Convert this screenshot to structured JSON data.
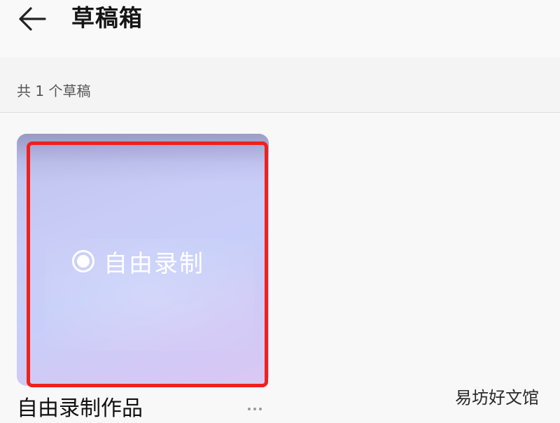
{
  "header": {
    "title": "草稿箱",
    "back_icon": "arrow-left-icon"
  },
  "draft_count": {
    "text": "共 1 个草稿"
  },
  "drafts": [
    {
      "thumbnail_label": "自由录制",
      "thumbnail_icon": "radio-icon",
      "name": "自由录制作品",
      "more_icon": "more-dots-icon"
    }
  ],
  "highlight": {
    "color": "#f0201c"
  },
  "watermark": {
    "text": "易坊好文馆"
  },
  "colors": {
    "background": "#f7f7f7",
    "title_text": "#151515",
    "secondary_text": "#555555",
    "thumbnail_gradient_start": "#bfc2ec",
    "thumbnail_gradient_end": "#d9c8f4"
  }
}
